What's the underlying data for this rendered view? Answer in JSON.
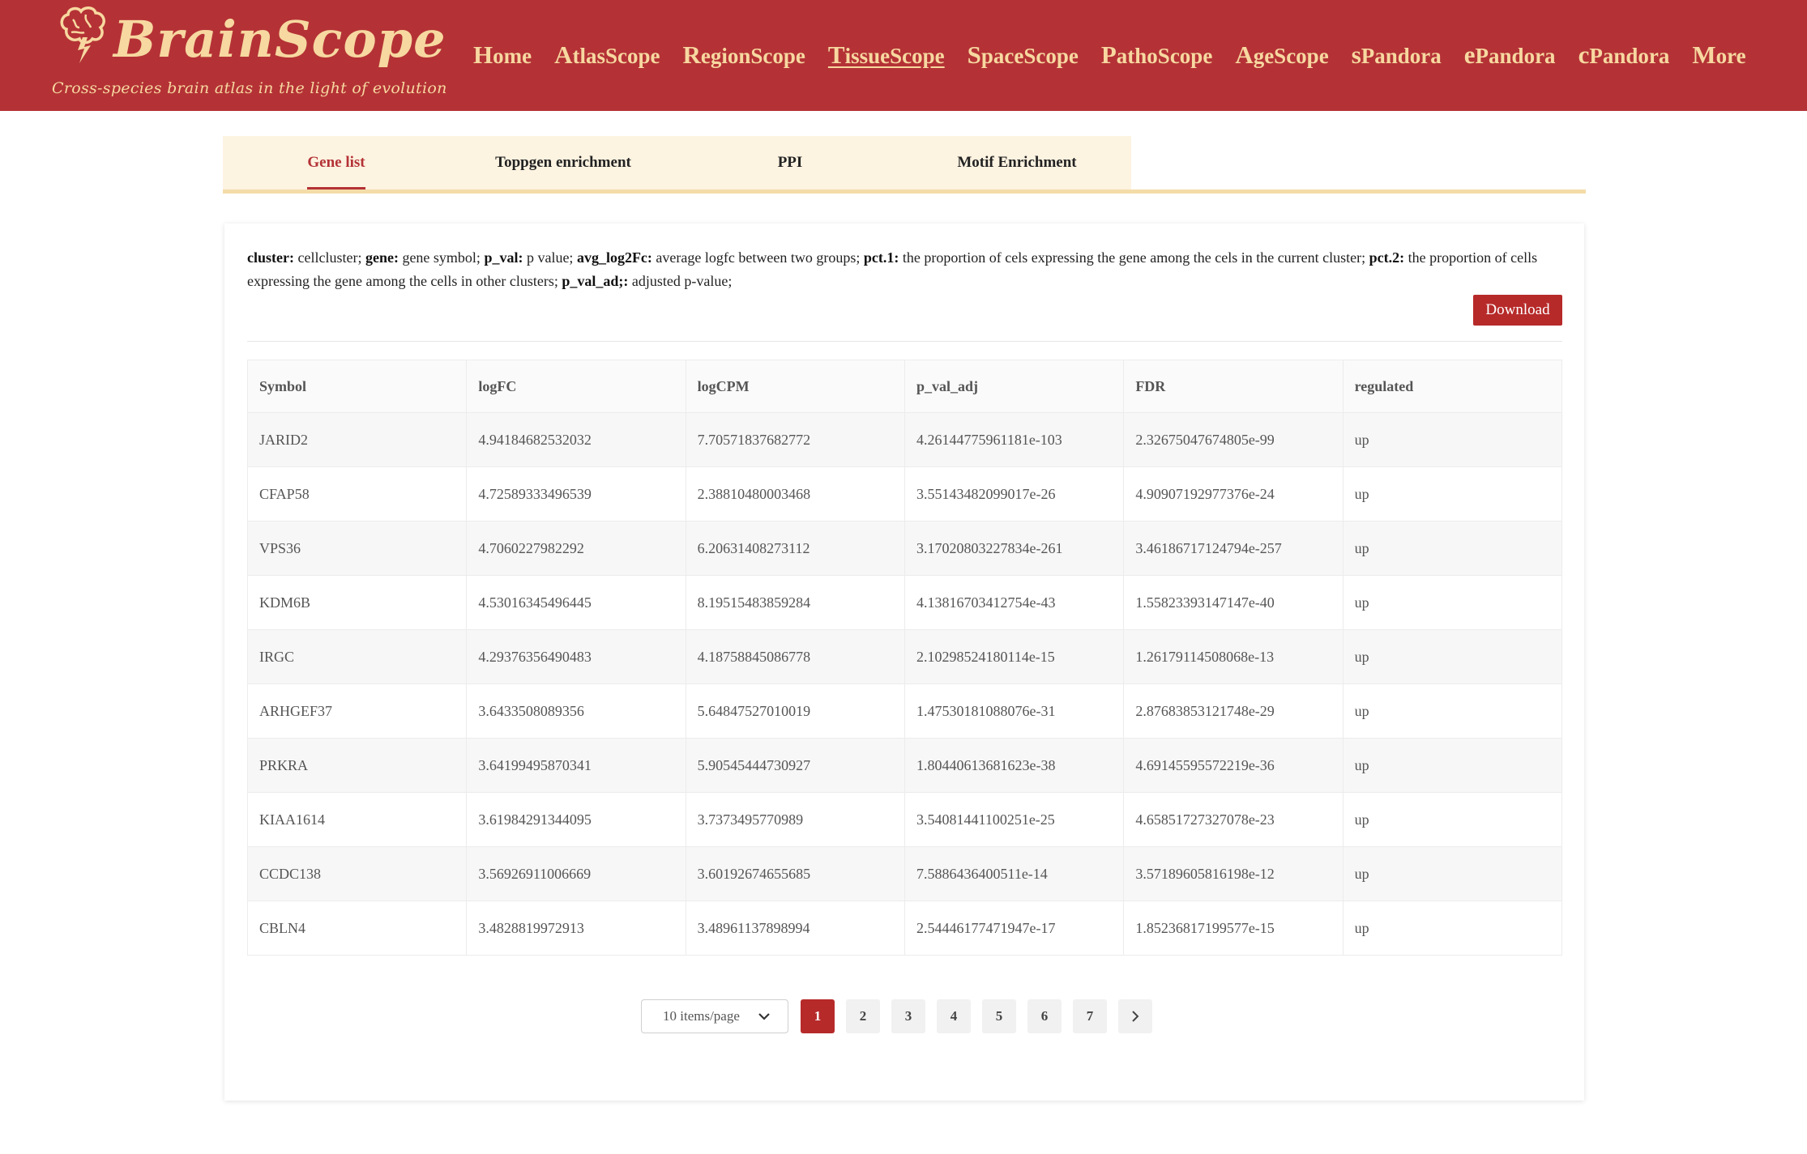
{
  "brand": {
    "name": "BrainScope",
    "tagline": "Cross-species brain atlas in the light of evolution",
    "logo_icon": "brain-lightning-icon",
    "color": "#b43236",
    "text_color": "#f7d8a0"
  },
  "nav": [
    {
      "cap": "H",
      "rest": "ome"
    },
    {
      "cap": "A",
      "rest": "tlasScope"
    },
    {
      "cap": "R",
      "rest": "egionScope"
    },
    {
      "cap": "T",
      "rest": "issueScope",
      "active": true
    },
    {
      "cap": "S",
      "rest": "paceScope"
    },
    {
      "cap": "P",
      "rest": "athoScope"
    },
    {
      "cap": "A",
      "rest": "geScope"
    },
    {
      "cap": "s",
      "rest": "Pandora"
    },
    {
      "cap": "e",
      "rest": "Pandora"
    },
    {
      "cap": "c",
      "rest": "Pandora"
    },
    {
      "cap": "M",
      "rest": "ore"
    }
  ],
  "tabs": [
    "Gene list",
    "Toppgen enrichment",
    "PPI",
    "Motif Enrichment"
  ],
  "active_tab": "Gene list",
  "description": {
    "parts": [
      {
        "term": "cluster:",
        "text": " cellcluster; "
      },
      {
        "term": "gene:",
        "text": " gene symbol; "
      },
      {
        "term": "p_val:",
        "text": " p value; "
      },
      {
        "term": "avg_log2Fc:",
        "text": " average logfc between two groups; "
      },
      {
        "term": "pct.1:",
        "text": " the proportion of cels expressing the gene among the cels in the current cluster; "
      },
      {
        "term": "pct.2:",
        "text": " the proportion of cells expressing the gene among the cells in other clusters; "
      },
      {
        "term": "p_val_ad;:",
        "text": " adjusted p-value;"
      }
    ]
  },
  "download_label": "Download",
  "table": {
    "columns": [
      "Symbol",
      "logFC",
      "logCPM",
      "p_val_adj",
      "FDR",
      "regulated"
    ],
    "rows": [
      [
        "JARID2",
        "4.94184682532032",
        "7.70571837682772",
        "4.26144775961181e-103",
        "2.32675047674805e-99",
        "up"
      ],
      [
        "CFAP58",
        "4.72589333496539",
        "2.38810480003468",
        "3.55143482099017e-26",
        "4.90907192977376e-24",
        "up"
      ],
      [
        "VPS36",
        "4.7060227982292",
        "6.20631408273112",
        "3.17020803227834e-261",
        "3.46186717124794e-257",
        "up"
      ],
      [
        "KDM6B",
        "4.53016345496445",
        "8.19515483859284",
        "4.13816703412754e-43",
        "1.55823393147147e-40",
        "up"
      ],
      [
        "IRGC",
        "4.29376356490483",
        "4.18758845086778",
        "2.10298524180114e-15",
        "1.26179114508068e-13",
        "up"
      ],
      [
        "ARHGEF37",
        "3.6433508089356",
        "5.64847527010019",
        "1.47530181088076e-31",
        "2.87683853121748e-29",
        "up"
      ],
      [
        "PRKRA",
        "3.64199495870341",
        "5.90545444730927",
        "1.80440613681623e-38",
        "4.69145595572219e-36",
        "up"
      ],
      [
        "KIAA1614",
        "3.61984291344095",
        "3.7373495770989",
        "3.54081441100251e-25",
        "4.65851727327078e-23",
        "up"
      ],
      [
        "CCDC138",
        "3.56926911006669",
        "3.60192674655685",
        "7.5886436400511e-14",
        "3.57189605816198e-12",
        "up"
      ],
      [
        "CBLN4",
        "3.4828819972913",
        "3.48961137898994",
        "2.54446177471947e-17",
        "1.85236817199577e-15",
        "up"
      ]
    ]
  },
  "pagination": {
    "page_size_label": "10 items/page",
    "pages": [
      "1",
      "2",
      "3",
      "4",
      "5",
      "6",
      "7"
    ],
    "current": "1",
    "next_icon": "chevron-right-icon"
  }
}
